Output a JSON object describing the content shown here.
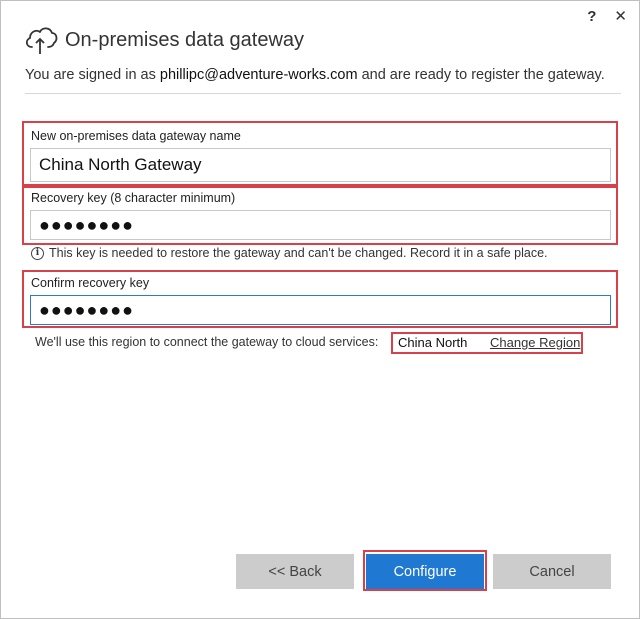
{
  "window": {
    "help_label": "?",
    "close_label": "✕"
  },
  "header": {
    "title": "On-premises data gateway",
    "signed_in_prefix": "You are signed in as ",
    "email": "phillipc@adventure-works.com",
    "signed_in_suffix": " and are ready to register the gateway."
  },
  "form": {
    "name_label": "New on-premises data gateway name",
    "name_value": "China North Gateway",
    "recovery_label": "Recovery key (8 character minimum)",
    "recovery_value": "●●●●●●●●",
    "info_text": "This key is needed to restore the gateway and can't be changed. Record it in a safe place.",
    "confirm_label": "Confirm recovery key",
    "confirm_value": "●●●●●●●●"
  },
  "region": {
    "text": "We'll use this region to connect the gateway to cloud services:",
    "name": "China North",
    "change_label": "Change Region"
  },
  "buttons": {
    "back": "<< Back",
    "configure": "Configure",
    "cancel": "Cancel"
  },
  "colors": {
    "highlight": "#d9414a",
    "primary": "#1f78d1",
    "focus_border": "#2f7bc6"
  }
}
